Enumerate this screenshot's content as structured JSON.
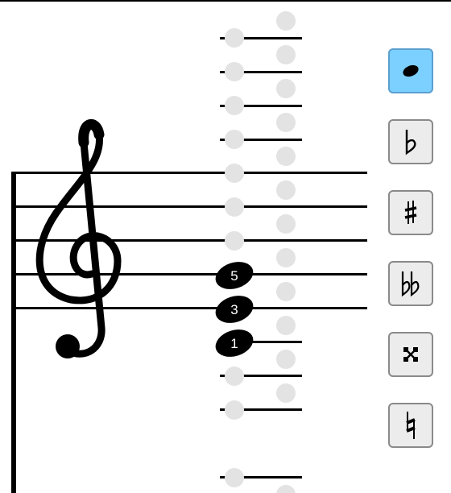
{
  "score": {
    "clef": "treble",
    "notes": [
      {
        "finger": "5",
        "state": "filled"
      },
      {
        "finger": "3",
        "state": "filled"
      },
      {
        "finger": "1",
        "state": "filled"
      }
    ]
  },
  "toolbar": {
    "selected": "note",
    "tools": [
      {
        "id": "note",
        "icon": "note-head-icon"
      },
      {
        "id": "flat",
        "icon": "flat-icon"
      },
      {
        "id": "sharp",
        "icon": "sharp-icon"
      },
      {
        "id": "double-flat",
        "icon": "double-flat-icon"
      },
      {
        "id": "double-sharp",
        "icon": "double-sharp-icon"
      },
      {
        "id": "natural",
        "icon": "natural-icon"
      }
    ]
  },
  "colors": {
    "selected_button": "#7cd0ff",
    "button": "#ececec",
    "placeholder_dot": "#e3e3e3",
    "ink": "#000000"
  }
}
